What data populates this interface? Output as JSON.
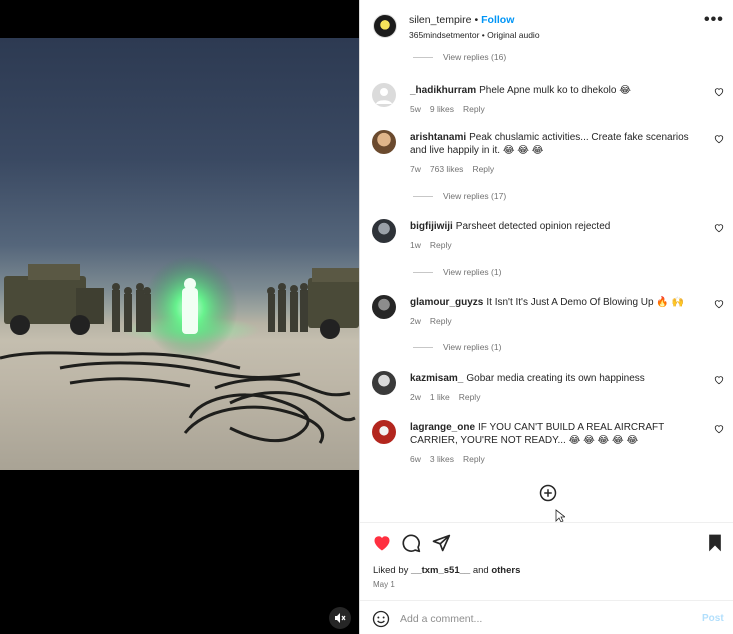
{
  "header": {
    "username": "silen_tempire",
    "separator": "•",
    "follow_label": "Follow",
    "subtitle": "365mindsetmentor • Original audio",
    "more_label": "•••"
  },
  "comments_section": {
    "top_view_replies": "View replies (16)",
    "comments": [
      {
        "user": "_hadikhurram",
        "text": "Phele Apne mulk ko to dhekolo 😂",
        "age": "5w",
        "likes": "9 likes",
        "reply": "Reply",
        "view_replies": ""
      },
      {
        "user": "arishtanami",
        "text": "Peak chuslamic activities... Create fake scenarios and live happily in it. 😂 😂 😂",
        "age": "7w",
        "likes": "763 likes",
        "reply": "Reply",
        "view_replies": "View replies (17)"
      },
      {
        "user": "bigfijiwiji",
        "text": "Parsheet detected opinion rejected",
        "age": "1w",
        "likes": "",
        "reply": "Reply",
        "view_replies": "View replies (1)"
      },
      {
        "user": "glamour_guyzs",
        "text": "It Isn't It's Just A Demo Of Blowing Up 🔥 🙌",
        "age": "2w",
        "likes": "",
        "reply": "Reply",
        "view_replies": "View replies (1)"
      },
      {
        "user": "kazmisam_",
        "text": "Gobar media creating its own happiness",
        "age": "2w",
        "likes": "1 like",
        "reply": "Reply",
        "view_replies": ""
      },
      {
        "user": "lagrange_one",
        "text": "IF YOU CAN'T BUILD A REAL AIRCRAFT CARRIER, YOU'RE NOT READY... 😂 😂 😂 😂 😂",
        "age": "6w",
        "likes": "3 likes",
        "reply": "Reply",
        "view_replies": ""
      }
    ]
  },
  "footer": {
    "liked_by_prefix": "Liked by ",
    "liked_by_user": "__txm_s51__",
    "liked_by_and": " and ",
    "liked_by_others": "others",
    "date": "May 1",
    "comment_placeholder": "Add a comment...",
    "post_label": "Post"
  },
  "colors": {
    "accent": "#0095f6",
    "like_red": "#ff3040",
    "glow_green": "#5dff8a"
  }
}
